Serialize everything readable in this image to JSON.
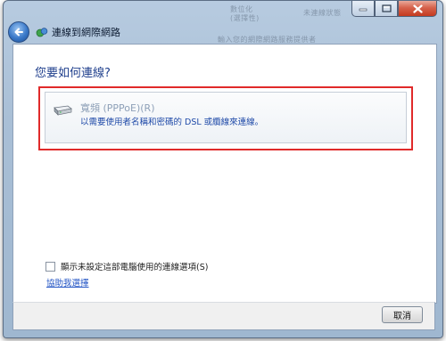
{
  "window": {
    "title": "連線到網際網路",
    "background_text": [
      "數位化",
      "(選擇性)",
      "未連線狀態",
      "輸入您的網際網路服務提供者"
    ]
  },
  "caption_buttons": {
    "minimize_icon": "minimize-icon",
    "maximize_icon": "maximize-icon",
    "close_icon": "close-icon"
  },
  "nav": {
    "back_icon": "back-arrow-icon",
    "title": "連線到網際網路"
  },
  "main": {
    "heading": "您要如何連線?",
    "option": {
      "title": "寬頻 (PPPoE)(R)",
      "description": "以需要使用者名稱和密碼的 DSL 或纜線來連線。",
      "icon": "dsl-modem-icon",
      "highlight_color": "#e02a2a"
    },
    "checkbox_label": "顯示未設定這部電腦使用的連線選項(S)",
    "help_link": "協助我選擇"
  },
  "footer": {
    "cancel_label": "取消"
  },
  "colors": {
    "heading": "#1e3e8c",
    "link": "#1f52c4",
    "highlight": "#e02a2a"
  }
}
